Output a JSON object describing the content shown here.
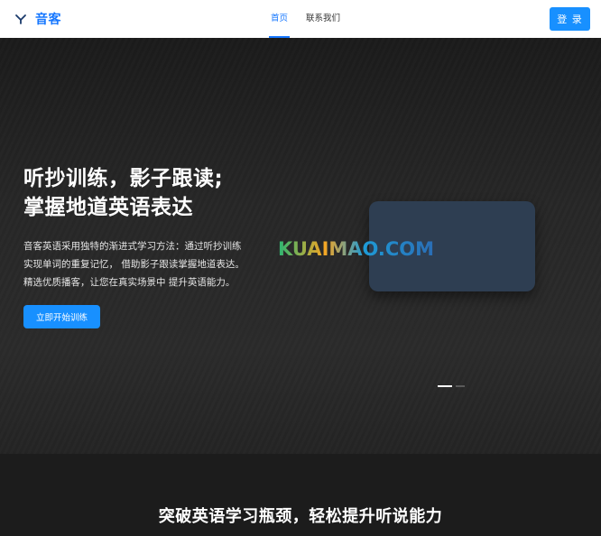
{
  "header": {
    "brand": "音客",
    "nav": [
      {
        "label": "首页",
        "active": true
      },
      {
        "label": "联系我们",
        "active": false
      }
    ],
    "login_label": "登 录"
  },
  "hero": {
    "title_line1": "听抄训练，影子跟读;",
    "title_line2": "掌握地道英语表达",
    "desc_line1": "音客英语采用独特的渐进式学习方法：通过听抄训练",
    "desc_line2": "实现单词的重复记忆， 借助影子跟读掌握地道表达。",
    "desc_line3": "精选优质播客，让您在真实场景中 提升英语能力。",
    "cta_label": "立即开始训练",
    "watermark": "KUAIMAO.COM",
    "slides_total": 2,
    "slide_active": 1
  },
  "section": {
    "title": "突破英语学习瓶颈，轻松提升听说能力"
  },
  "colors": {
    "accent": "#1890ff",
    "brand": "#1677ff",
    "card": "#2e3e52"
  },
  "icons": {
    "logo": "brand-logo-icon"
  }
}
